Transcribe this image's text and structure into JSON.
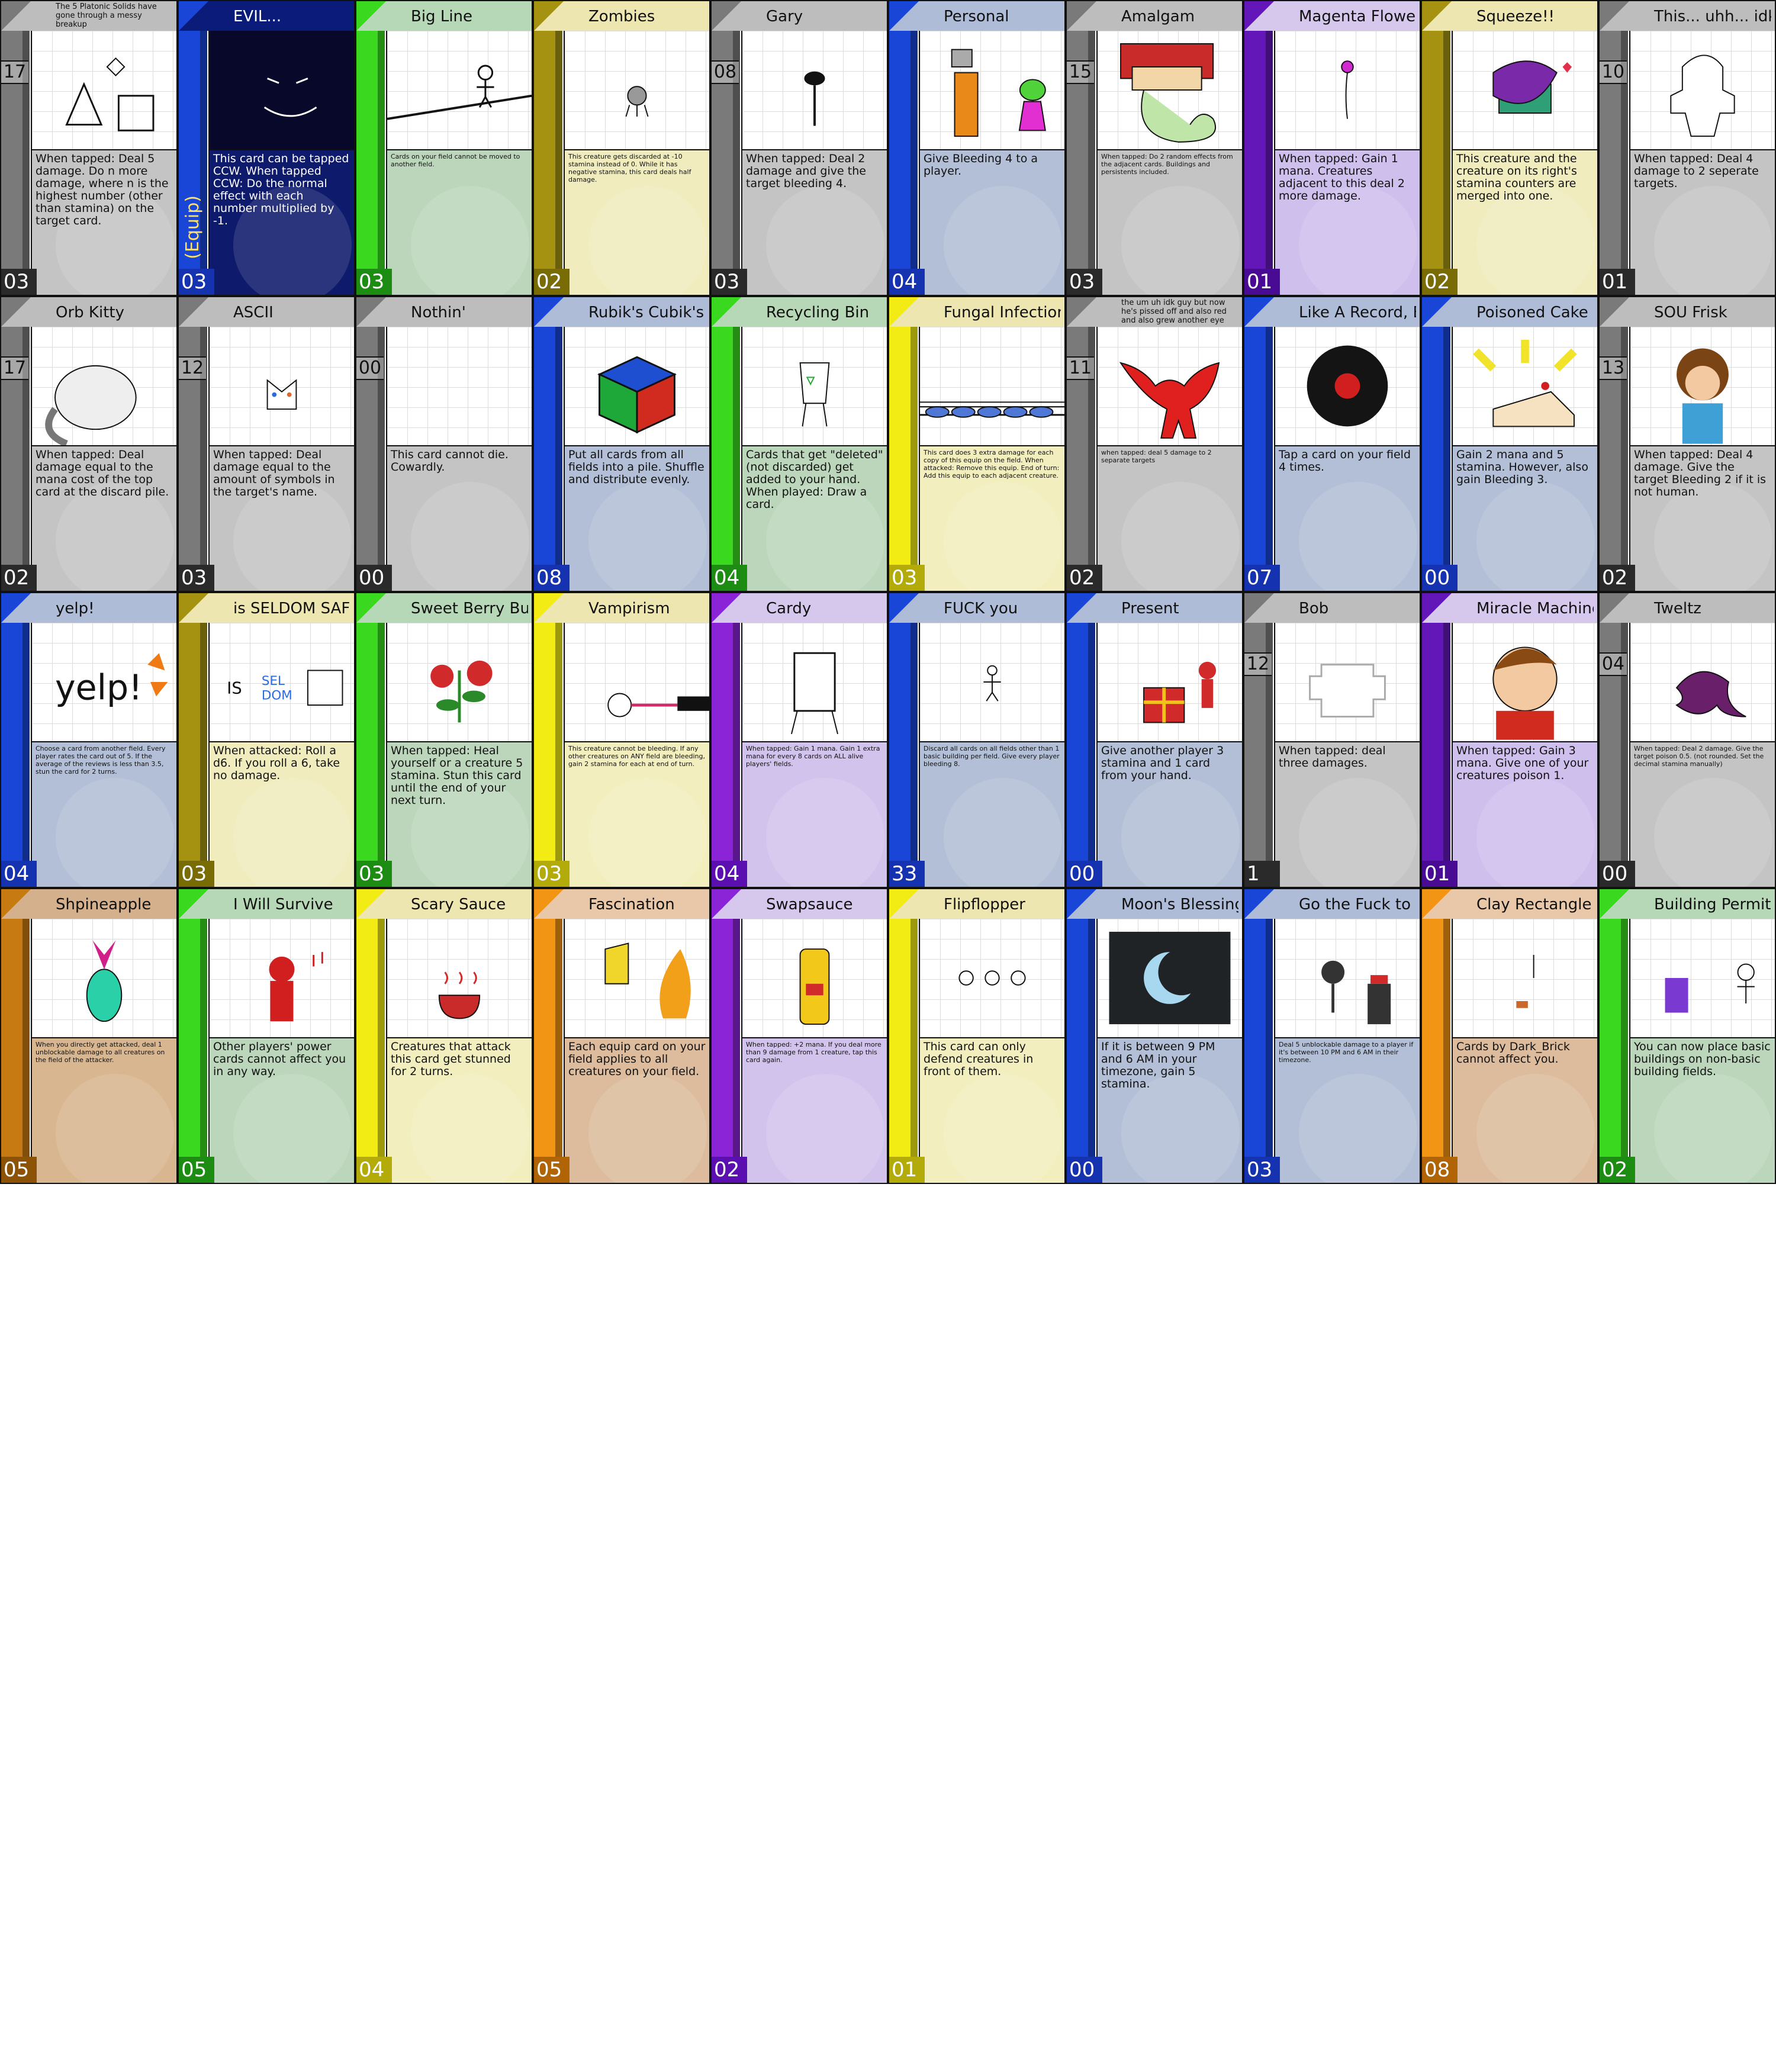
{
  "colors": {
    "gray": {
      "band": "#bdbdbd",
      "bar": "#7a7a7a",
      "text": "#c4c4c4",
      "num": "#2a2a2a"
    },
    "blue": {
      "band": "#aebcd8",
      "bar": "#1946d6",
      "text": "#b2bfd6",
      "num": "#1533b0"
    },
    "green": {
      "band": "#b6d8b6",
      "bar": "#3ad81f",
      "text": "#bcd6bb",
      "num": "#1d8c12"
    },
    "olive": {
      "band": "#eee6b0",
      "bar": "#a49210",
      "text": "#f0ecbe",
      "num": "#7a6c05"
    },
    "yellow": {
      "band": "#eee6b0",
      "bar": "#f2ec14",
      "text": "#f2eebe",
      "num": "#b3ab0a"
    },
    "purple": {
      "band": "#d6c8ec",
      "bar": "#8b24d6",
      "text": "#d2c3ec",
      "num": "#5c0fb0"
    },
    "orange": {
      "band": "#e8c8a8",
      "bar": "#f29414",
      "text": "#dcbc9c",
      "num": "#b06405"
    },
    "violet": {
      "band": "#d6c8ec",
      "bar": "#6417b8",
      "text": "#cfbfec",
      "num": "#4a0b94"
    },
    "brown": {
      "band": "#d4b08c",
      "bar": "#c87a12",
      "text": "#d8b690",
      "num": "#8c5206"
    }
  },
  "cards": [
    {
      "name": "The 5 Platonic Solids have gone through a messy breakup",
      "cost": "17",
      "num": "03",
      "theme": "gray",
      "text": "When tapped: Deal 5 damage. Do n more damage, where n is the highest number (other than stamina) on the target card.",
      "art": "solids",
      "smallTitle": true
    },
    {
      "name": "EVIL...",
      "cost": "",
      "num": "03",
      "theme": "blue",
      "text": "This card can be tapped CCW. When tapped CCW: Do the normal effect with each number multiplied by -1.",
      "art": "evil",
      "dark": true,
      "tag": "(Equip)"
    },
    {
      "name": "Big Line",
      "cost": "",
      "num": "03",
      "theme": "green",
      "text": "Cards on your field cannot be moved to another field.",
      "art": "bigline",
      "smallText": true
    },
    {
      "name": "Zombies",
      "cost": "",
      "num": "02",
      "theme": "olive",
      "text": "This creature gets discarded at -10 stamina instead of 0. While it has negative stamina, this card deals half damage.",
      "art": "zombie",
      "smallText": true
    },
    {
      "name": "Gary",
      "cost": "08",
      "num": "03",
      "theme": "gray",
      "text": "When tapped: Deal 2 damage and give the target bleeding 4.",
      "art": "gary"
    },
    {
      "name": "Personal",
      "cost": "",
      "num": "04",
      "theme": "blue",
      "text": "Give Bleeding 4 to a player.",
      "art": "personal"
    },
    {
      "name": "Amalgam",
      "cost": "15",
      "num": "03",
      "theme": "gray",
      "text": "When tapped: Do 2 random effects from the adjacent cards. Buildings and persistents included.",
      "art": "amalgam",
      "smallText": true
    },
    {
      "name": "Magenta Flower",
      "cost": "",
      "num": "01",
      "theme": "violet",
      "text": "When tapped: Gain 1 mana. Creatures adjacent to this deal 2 more damage.",
      "art": "flower"
    },
    {
      "name": "Squeeze!!",
      "cost": "",
      "num": "02",
      "theme": "olive",
      "text": "This creature and the creature on its right's stamina counters are merged into one.",
      "art": "squeeze"
    },
    {
      "name": "This... uhh... idk",
      "cost": "10",
      "num": "01",
      "theme": "gray",
      "text": "When tapped: Deal 4 damage to 2 seperate targets.",
      "art": "idk"
    },
    {
      "name": "Orb Kitty",
      "cost": "17",
      "num": "02",
      "theme": "gray",
      "text": "When tapped: Deal damage equal to the mana cost of the top card at the discard pile.",
      "art": "orbkitty"
    },
    {
      "name": "ASCII",
      "cost": "12",
      "num": "03",
      "theme": "gray",
      "text": "When tapped: Deal damage equal to the amount of symbols in the target's name.",
      "art": "ascii"
    },
    {
      "name": "Nothin'",
      "cost": "00",
      "num": "00",
      "theme": "gray",
      "text": "This card cannot die. Cowardly.",
      "art": "none"
    },
    {
      "name": "Rubik's Cubik's",
      "cost": "",
      "num": "08",
      "theme": "blue",
      "text": "Put all cards from all fields into a pile. Shuffle and distribute evenly.",
      "art": "rubik"
    },
    {
      "name": "Recycling Bin",
      "cost": "",
      "num": "04",
      "theme": "green",
      "text": "Cards that get \"deleted\" (not discarded) get added to your hand. When played: Draw a card.",
      "art": "bin"
    },
    {
      "name": "Fungal Infection",
      "cost": "",
      "num": "03",
      "theme": "yellow",
      "text": "This card does 3 extra damage for each copy of this equip on the field. When attacked: Remove this equip. End of turn: Add this equip to each adjacent creature.",
      "art": "fungal",
      "smallText": true
    },
    {
      "name": "the um uh idk guy but now he's pissed off and also red and also grew another eye",
      "cost": "11",
      "num": "02",
      "theme": "gray",
      "text": "when tapped: deal 5 damage to 2 separate targets",
      "art": "redguy",
      "smallTitle": true,
      "smallText": true
    },
    {
      "name": "Like A Record, Baby",
      "cost": "",
      "num": "07",
      "theme": "blue",
      "text": "Tap a card on your field 4 times.",
      "art": "record"
    },
    {
      "name": "Poisoned Cake",
      "cost": "",
      "num": "00",
      "theme": "blue",
      "text": "Gain 2 mana and 5 stamina. However, also gain Bleeding 3.",
      "art": "cake"
    },
    {
      "name": "SOU Frisk",
      "cost": "13",
      "num": "02",
      "theme": "gray",
      "text": "When tapped: Deal 4 damage. Give the target Bleeding 2 if it is not human.",
      "art": "frisk"
    },
    {
      "name": "yelp!",
      "cost": "",
      "num": "04",
      "theme": "blue",
      "text": "Choose a card from another field. Every player rates the card out of 5. If the average of the reviews is less than 3.5, stun the card for 2 turns.",
      "art": "yelp",
      "smallText": true
    },
    {
      "name": "is SELDOM SAFE",
      "cost": "",
      "num": "03",
      "theme": "olive",
      "text": "When attacked: Roll a d6. If you roll a 6, take no damage.",
      "art": "seldom"
    },
    {
      "name": "Sweet Berry Bush",
      "cost": "",
      "num": "03",
      "theme": "green",
      "text": "When tapped: Heal yourself or a creature 5 stamina. Stun this card until the end of your next turn.",
      "art": "berry"
    },
    {
      "name": "Vampirism",
      "cost": "",
      "num": "03",
      "theme": "yellow",
      "text": "This creature cannot be bleeding. If any other creatures on ANY field are bleeding, gain 2 stamina for each at end of turn.",
      "art": "vampire",
      "smallText": true
    },
    {
      "name": "Cardy",
      "cost": "",
      "num": "04",
      "theme": "purple",
      "text": "When tapped: Gain 1 mana. Gain 1 extra mana for every 8 cards on ALL alive players' fields.",
      "art": "cardy",
      "smallText": true
    },
    {
      "name": "FUCK you",
      "cost": "",
      "num": "33",
      "theme": "blue",
      "text": "Discard all cards on all fields other than 1 basic building per field. Give every player bleeding 8.",
      "art": "fuck",
      "smallText": true
    },
    {
      "name": "Present",
      "cost": "",
      "num": "00",
      "theme": "blue",
      "text": "Give another player 3 stamina and 1 card from your hand.",
      "art": "present"
    },
    {
      "name": "Bob",
      "cost": "12",
      "num": "1",
      "theme": "gray",
      "text": "When tapped: deal three damages.",
      "art": "bob"
    },
    {
      "name": "Miracle Machine",
      "cost": "",
      "num": "01",
      "theme": "violet",
      "text": "When tapped: Gain 3 mana. Give one of your creatures poison 1.",
      "art": "miracle"
    },
    {
      "name": "Tweltz",
      "cost": "04",
      "num": "00",
      "theme": "gray",
      "text": "When tapped: Deal 2 damage. Give the target poison 0.5. (not rounded. Set the decimal stamina manually)",
      "art": "tweltz",
      "smallText": true
    },
    {
      "name": "Shpineapple",
      "cost": "",
      "num": "05",
      "theme": "brown",
      "text": "When you directly get attacked, deal 1 unblockable damage to all creatures on the field of the attacker.",
      "art": "pineapple",
      "smallText": true
    },
    {
      "name": "I Will Survive",
      "cost": "",
      "num": "05",
      "theme": "green",
      "text": "Other players' power cards cannot affect you in any way.",
      "art": "survive"
    },
    {
      "name": "Scary Sauce",
      "cost": "",
      "num": "04",
      "theme": "yellow",
      "text": "Creatures that attack this card get stunned for 2 turns.",
      "art": "sauce"
    },
    {
      "name": "Fascination",
      "cost": "",
      "num": "05",
      "theme": "orange",
      "text": "Each equip card on your field applies to all creatures on your field.",
      "art": "fascination"
    },
    {
      "name": "Swapsauce",
      "cost": "",
      "num": "02",
      "theme": "purple",
      "text": "When tapped: +2 mana. If you deal more than 9 damage from 1 creature, tap this card again.",
      "art": "swapsauce",
      "smallText": true
    },
    {
      "name": "Flipflopper",
      "cost": "",
      "num": "01",
      "theme": "yellow",
      "text": "This card can only defend creatures in front of them.",
      "art": "flip"
    },
    {
      "name": "Moon's Blessing",
      "cost": "",
      "num": "00",
      "theme": "blue",
      "text": "If it is between 9 PM and 6 AM in your timezone, gain 5 stamina.",
      "art": "moon"
    },
    {
      "name": "Go the Fuck to Sleep",
      "cost": "",
      "num": "03",
      "theme": "blue",
      "text": "Deal 5 unblockable damage to a player if it's between 10 PM and 6 AM in their timezone.",
      "art": "sleep",
      "smallText": true
    },
    {
      "name": "Clay Rectangle",
      "cost": "",
      "num": "08",
      "theme": "orange",
      "text": "Cards by Dark_Brick cannot affect you.",
      "art": "clay"
    },
    {
      "name": "Building Permit",
      "cost": "",
      "num": "02",
      "theme": "green",
      "text": "You can now place basic buildings on non-basic building fields.",
      "art": "permit"
    }
  ]
}
